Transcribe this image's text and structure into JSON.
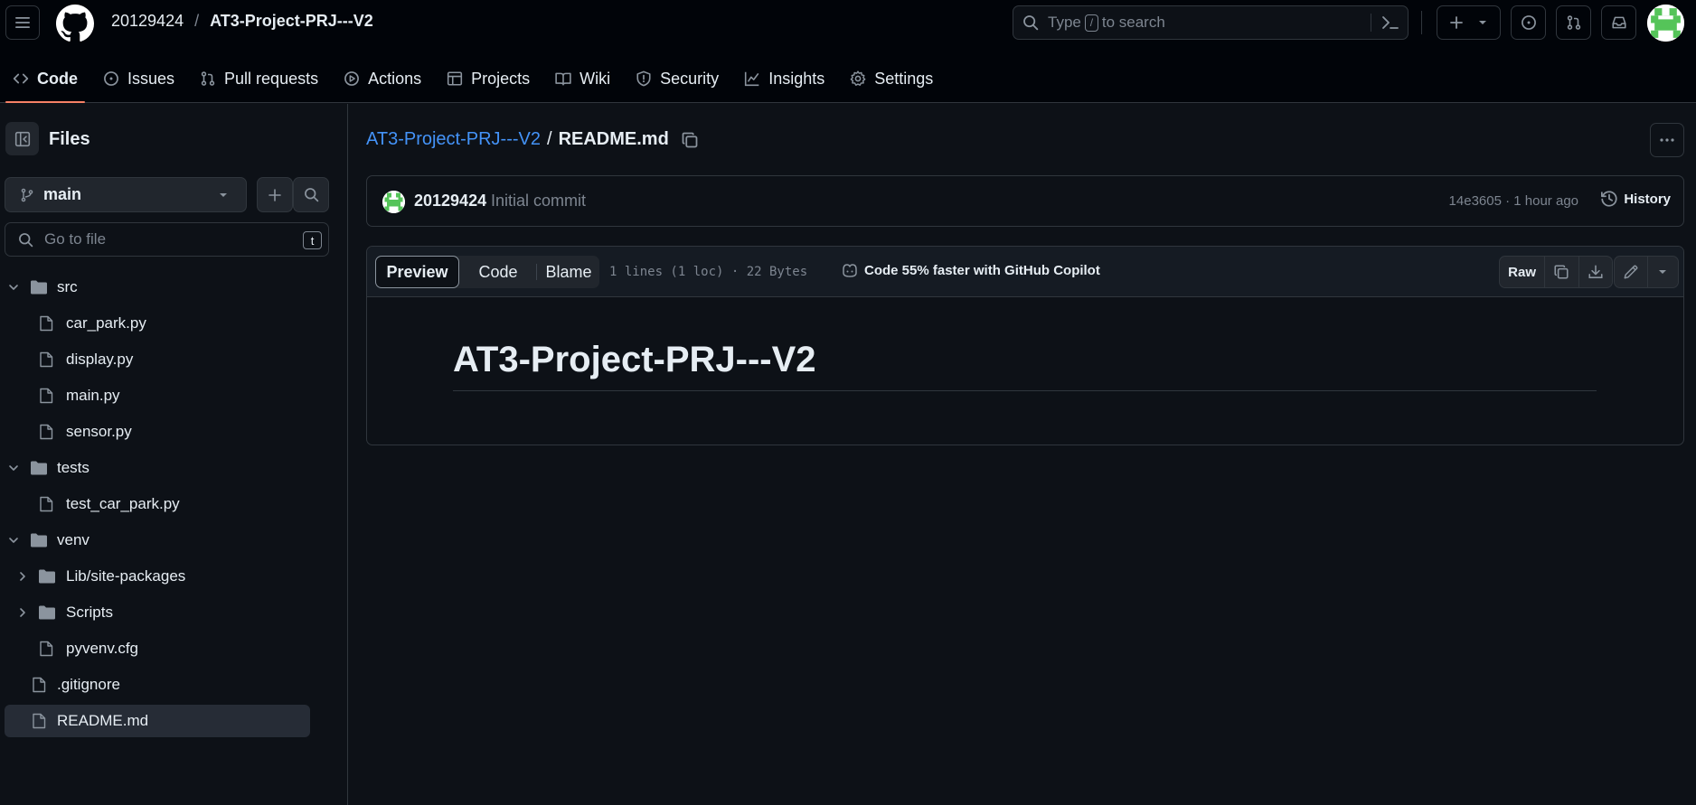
{
  "header": {
    "owner": "20129424",
    "separator": "/",
    "repo": "AT3-Project-PRJ---V2",
    "search_before": "Type",
    "search_key": "/",
    "search_after": "to search"
  },
  "repo_nav": [
    {
      "label": "Code",
      "icon": "code-icon",
      "active": true
    },
    {
      "label": "Issues",
      "icon": "issue-icon"
    },
    {
      "label": "Pull requests",
      "icon": "pull-request-icon"
    },
    {
      "label": "Actions",
      "icon": "play-icon"
    },
    {
      "label": "Projects",
      "icon": "table-icon"
    },
    {
      "label": "Wiki",
      "icon": "book-icon"
    },
    {
      "label": "Security",
      "icon": "shield-icon"
    },
    {
      "label": "Insights",
      "icon": "graph-icon"
    },
    {
      "label": "Settings",
      "icon": "gear-icon"
    }
  ],
  "sidebar": {
    "title": "Files",
    "branch": "main",
    "goto_placeholder": "Go to file",
    "goto_key": "t",
    "tree": [
      {
        "label": "src",
        "type": "folder",
        "expanded": true,
        "depth": 0
      },
      {
        "label": "car_park.py",
        "type": "file",
        "depth": 1
      },
      {
        "label": "display.py",
        "type": "file",
        "depth": 1
      },
      {
        "label": "main.py",
        "type": "file",
        "depth": 1
      },
      {
        "label": "sensor.py",
        "type": "file",
        "depth": 1
      },
      {
        "label": "tests",
        "type": "folder",
        "expanded": true,
        "depth": 0
      },
      {
        "label": "test_car_park.py",
        "type": "file",
        "depth": 1
      },
      {
        "label": "venv",
        "type": "folder",
        "expanded": true,
        "depth": 0
      },
      {
        "label": "Lib/site-packages",
        "type": "folder",
        "expanded": false,
        "depth": 1
      },
      {
        "label": "Scripts",
        "type": "folder",
        "expanded": false,
        "depth": 1
      },
      {
        "label": "pyvenv.cfg",
        "type": "file",
        "depth": 1
      },
      {
        "label": ".gitignore",
        "type": "file",
        "depth": 0
      },
      {
        "label": "README.md",
        "type": "file",
        "depth": 0,
        "selected": true
      }
    ]
  },
  "main": {
    "path_repo": "AT3-Project-PRJ---V2",
    "path_sep": "/",
    "path_file": "README.md",
    "commit": {
      "author": "20129424",
      "message": "Initial commit",
      "meta": "14e3605 · 1 hour ago",
      "history_label": "History"
    },
    "file": {
      "tabs": [
        "Preview",
        "Code",
        "Blame"
      ],
      "info": "1 lines (1 loc) · 22 Bytes",
      "copilot": "Code 55% faster with GitHub Copilot",
      "raw_label": "Raw"
    },
    "readme_heading": "AT3-Project-PRJ---V2"
  },
  "colors": {
    "accent_link": "#4493f8",
    "active_tab_underline": "#f78166",
    "background": "#0d1117",
    "header_bg": "#010409"
  }
}
